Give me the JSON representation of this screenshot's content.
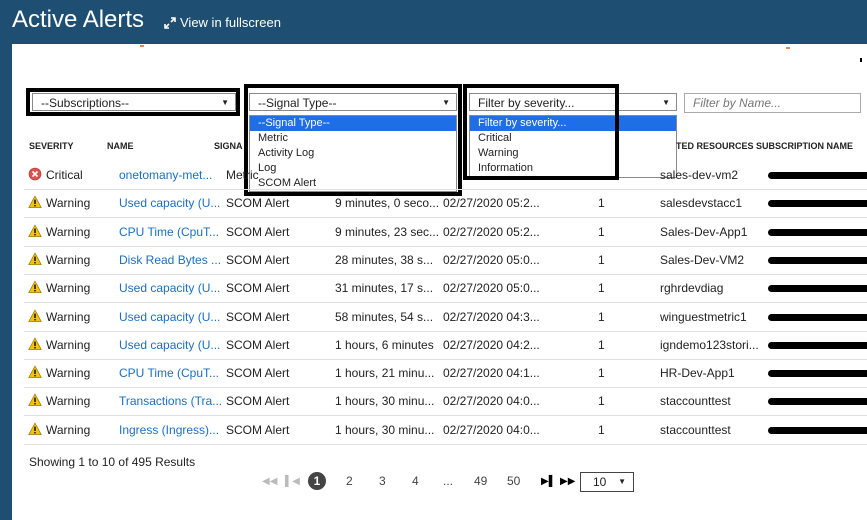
{
  "header": {
    "title": "Active Alerts",
    "fullscreen_label": "View in fullscreen"
  },
  "filters": {
    "subscriptions": {
      "value": "--Subscriptions--"
    },
    "signal_type": {
      "value": "--Signal Type--",
      "options": [
        "--Signal Type--",
        "Metric",
        "Activity Log",
        "Log",
        "SCOM Alert"
      ]
    },
    "severity": {
      "value": "Filter by severity...",
      "options": [
        "Filter by severity...",
        "Critical",
        "Warning",
        "Information"
      ]
    },
    "name": {
      "placeholder": "Filter by Name..."
    }
  },
  "table": {
    "headers": {
      "severity": "SEVERITY",
      "name": "NAME",
      "signal": "SIGNA",
      "resources": "TED RESOURCES",
      "subscription": "SUBSCRIPTION NAME"
    },
    "rows": [
      {
        "severity": "Critical",
        "name": "onetomany-met...",
        "signal": "Metric",
        "duration": "",
        "time": "",
        "count": "",
        "resource": "sales-dev-vm2"
      },
      {
        "severity": "Warning",
        "name": "Used capacity (U...",
        "signal": "SCOM Alert",
        "duration": "9 minutes, 0 seco...",
        "time": "02/27/2020 05:2...",
        "count": "1",
        "resource": "salesdevstacc1"
      },
      {
        "severity": "Warning",
        "name": "CPU Time (CpuT...",
        "signal": "SCOM Alert",
        "duration": "9 minutes, 23 sec...",
        "time": "02/27/2020 05:2...",
        "count": "1",
        "resource": "Sales-Dev-App1"
      },
      {
        "severity": "Warning",
        "name": "Disk Read Bytes ...",
        "signal": "SCOM Alert",
        "duration": "28 minutes, 38 s...",
        "time": "02/27/2020 05:0...",
        "count": "1",
        "resource": "Sales-Dev-VM2"
      },
      {
        "severity": "Warning",
        "name": "Used capacity (U...",
        "signal": "SCOM Alert",
        "duration": "31 minutes, 17 s...",
        "time": "02/27/2020 05:0...",
        "count": "1",
        "resource": "rghrdevdiag"
      },
      {
        "severity": "Warning",
        "name": "Used capacity (U...",
        "signal": "SCOM Alert",
        "duration": "58 minutes, 54 s...",
        "time": "02/27/2020 04:3...",
        "count": "1",
        "resource": "winguestmetric1"
      },
      {
        "severity": "Warning",
        "name": "Used capacity (U...",
        "signal": "SCOM Alert",
        "duration": "1 hours, 6 minutes",
        "time": "02/27/2020 04:2...",
        "count": "1",
        "resource": "igndemo123stori..."
      },
      {
        "severity": "Warning",
        "name": "CPU Time (CpuT...",
        "signal": "SCOM Alert",
        "duration": "1 hours, 21 minu...",
        "time": "02/27/2020 04:1...",
        "count": "1",
        "resource": "HR-Dev-App1"
      },
      {
        "severity": "Warning",
        "name": "Transactions (Tra...",
        "signal": "SCOM Alert",
        "duration": "1 hours, 30 minu...",
        "time": "02/27/2020 04:0...",
        "count": "1",
        "resource": "staccounttest"
      },
      {
        "severity": "Warning",
        "name": "Ingress (Ingress)...",
        "signal": "SCOM Alert",
        "duration": "1 hours, 30 minu...",
        "time": "02/27/2020 04:0...",
        "count": "1",
        "resource": "staccounttest"
      }
    ]
  },
  "footer": {
    "results": "Showing 1 to 10 of 495 Results"
  },
  "pagination": {
    "current": "1",
    "pages": [
      "2",
      "3",
      "4",
      "...",
      "49",
      "50"
    ],
    "page_size": "10"
  },
  "colors": {
    "header_bg": "#1e4f73",
    "link": "#1a6fc2",
    "selected_option": "#1e6ee6"
  }
}
